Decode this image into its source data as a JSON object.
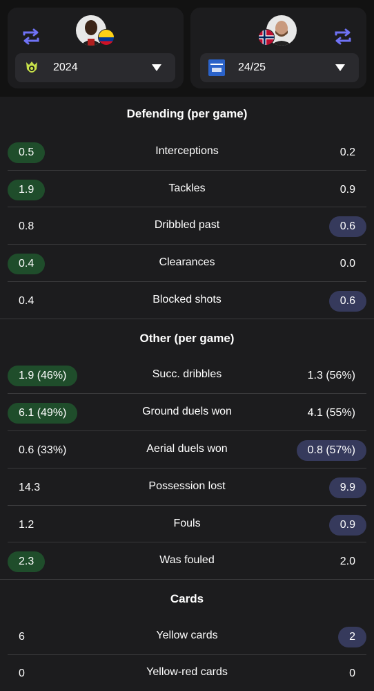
{
  "header": {
    "left_player": {
      "season": "2024",
      "league_icon": "brasileirao-icon",
      "flag": "colombia-flag"
    },
    "right_player": {
      "season": "24/25",
      "league_icon": "eredivisie-icon",
      "flag": "norway-flag"
    },
    "swap_icon": "swap-arrows-icon",
    "colors": {
      "accent": "#6f72f5",
      "green_pill": "#1f4d2b",
      "blue_pill": "#363a5c"
    }
  },
  "sections": {
    "defending": {
      "title": "Defending (per game)",
      "rows": [
        {
          "label": "Interceptions",
          "left": "0.5",
          "right": "0.2"
        },
        {
          "label": "Tackles",
          "left": "1.9",
          "right": "0.9"
        },
        {
          "label": "Dribbled past",
          "left": "0.8",
          "right": "0.6"
        },
        {
          "label": "Clearances",
          "left": "0.4",
          "right": "0.0"
        },
        {
          "label": "Blocked shots",
          "left": "0.4",
          "right": "0.6"
        }
      ]
    },
    "other": {
      "title": "Other (per game)",
      "rows": [
        {
          "label": "Succ. dribbles",
          "left": "1.9 (46%)",
          "right": "1.3 (56%)"
        },
        {
          "label": "Ground duels won",
          "left": "6.1 (49%)",
          "right": "4.1 (55%)"
        },
        {
          "label": "Aerial duels won",
          "left": "0.6 (33%)",
          "right": "0.8 (57%)"
        },
        {
          "label": "Possession lost",
          "left": "14.3",
          "right": "9.9"
        },
        {
          "label": "Fouls",
          "left": "1.2",
          "right": "0.9"
        },
        {
          "label": "Was fouled",
          "left": "2.3",
          "right": "2.0"
        }
      ]
    },
    "cards": {
      "title": "Cards",
      "rows": [
        {
          "label": "Yellow cards",
          "left": "6",
          "right": "2"
        },
        {
          "label": "Yellow-red cards",
          "left": "0",
          "right": "0"
        }
      ]
    }
  }
}
